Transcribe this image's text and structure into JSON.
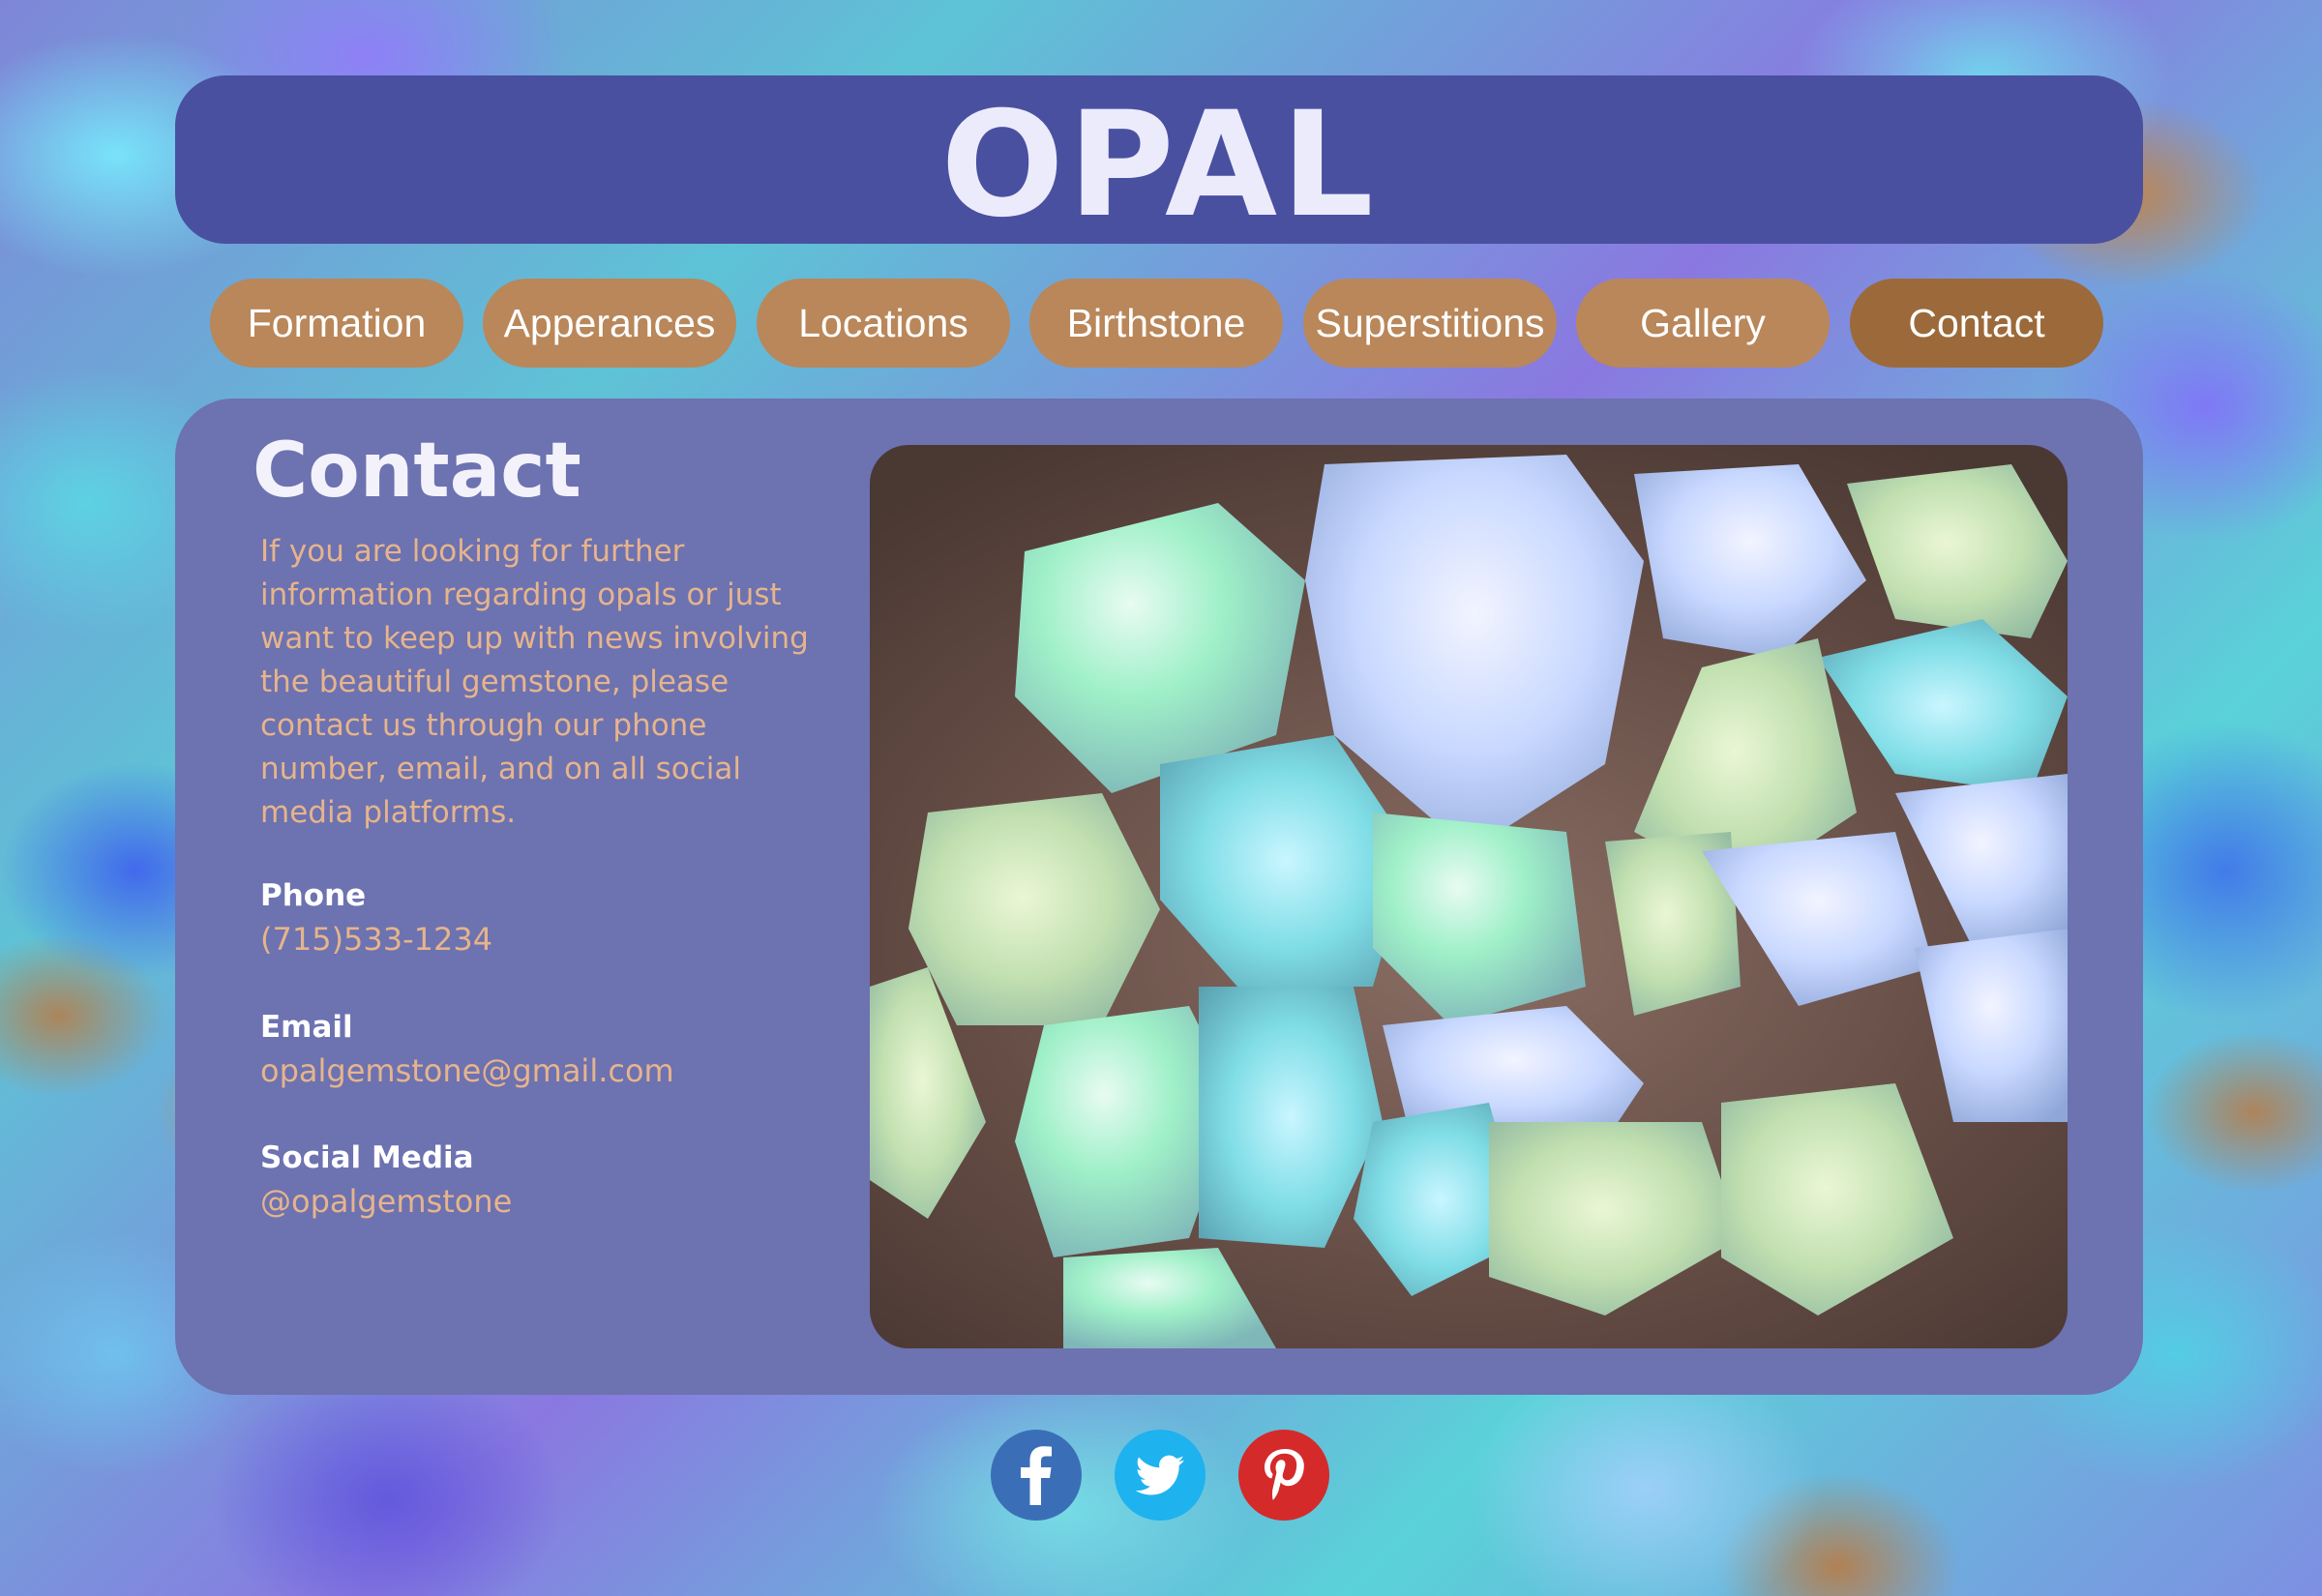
{
  "header": {
    "title": "OPAL"
  },
  "nav": {
    "items": [
      {
        "label": "Formation"
      },
      {
        "label": "Apperances"
      },
      {
        "label": "Locations"
      },
      {
        "label": "Birthstone"
      },
      {
        "label": "Superstitions"
      },
      {
        "label": "Gallery"
      },
      {
        "label": "Contact"
      }
    ],
    "active": "Contact"
  },
  "contact": {
    "heading": "Contact",
    "intro": "If you are looking for further information regarding opals or just want to keep up with news involving the beautiful gemstone, please contact us through our phone number, email, and on all social media platforms.",
    "phone": {
      "label": "Phone",
      "value": "(715)533-1234"
    },
    "email": {
      "label": "Email",
      "value": "opalgemstone@gmail.com"
    },
    "social": {
      "label": "Social Media",
      "value": "@opalgemstone"
    }
  },
  "social_icons": [
    {
      "icon": "facebook-icon",
      "color": "#3a6fb8"
    },
    {
      "icon": "twitter-icon",
      "color": "#1eb2ef"
    },
    {
      "icon": "pinterest-icon",
      "color": "#d42a2a"
    }
  ],
  "colors": {
    "header_bg": "#4a50a0",
    "panel_bg": "#6d72b0",
    "nav_btn": "#b9875a",
    "nav_btn_active": "#9c6a3a",
    "accent_text": "#e6b48c"
  }
}
